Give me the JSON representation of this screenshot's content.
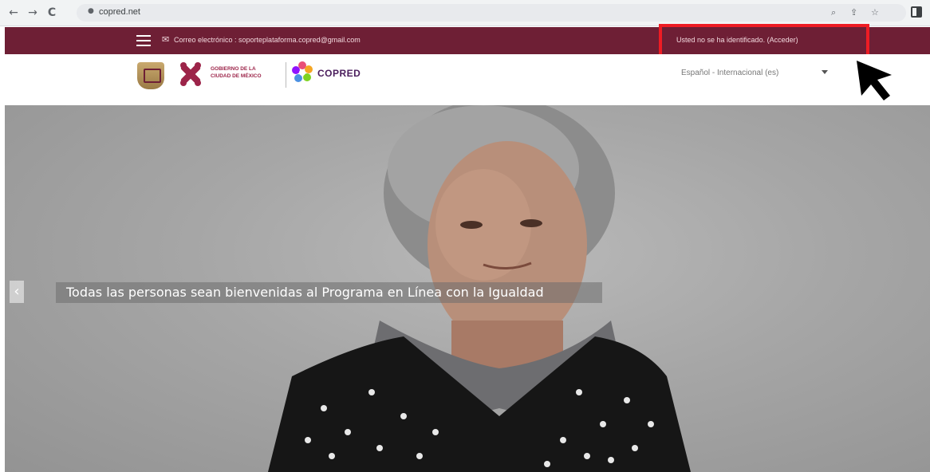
{
  "browser": {
    "url": "copred.net",
    "back_icon": "←",
    "forward_icon": "→",
    "reload_icon": "C"
  },
  "topbar": {
    "contact_text": "Correo electrónico : soporteplataforma.copred@gmail.com",
    "login_text": "Usted no se ha identificado. (Acceder)"
  },
  "header": {
    "cdmx_line1": "GOBIERNO DE LA",
    "cdmx_line2": "CIUDAD DE MÉXICO",
    "copred_label": "COPRED",
    "language": "Español - Internacional (es)"
  },
  "hero": {
    "caption": "Todas las personas sean bienvenidas al Programa en Línea con la Igualdad",
    "prev_icon": "‹"
  },
  "colors": {
    "brand_maroon": "#6e1f35",
    "highlight_red": "#ee1c24"
  }
}
